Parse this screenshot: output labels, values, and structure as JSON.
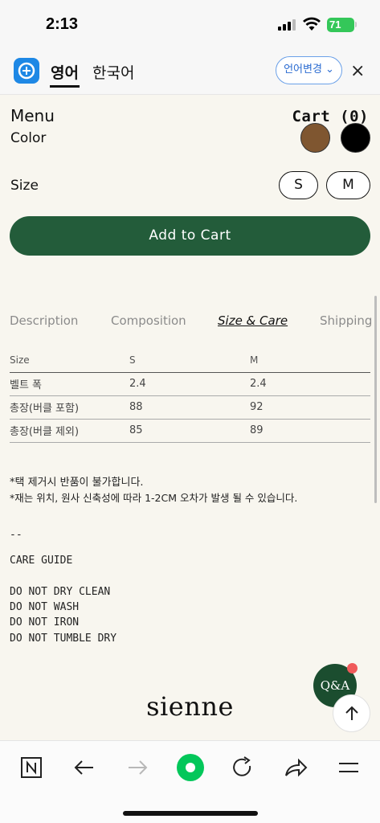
{
  "status": {
    "time": "2:13",
    "battery": "71"
  },
  "translate": {
    "tab_en": "영어",
    "tab_ko": "한국어",
    "change_label": "언어변경",
    "close": "×"
  },
  "header": {
    "menu": "Menu",
    "cart": "Cart (0)"
  },
  "options": {
    "color_label": "Color",
    "colors": [
      "#7f5630",
      "#000000"
    ],
    "size_label": "Size",
    "sizes": [
      "S",
      "M"
    ]
  },
  "add_to_cart": "Add to Cart",
  "tabs": [
    "Description",
    "Composition",
    "Size & Care",
    "Shipping"
  ],
  "active_tab": "Size & Care",
  "size_table": {
    "headers": [
      "Size",
      "S",
      "M"
    ],
    "rows": [
      [
        "벨트 폭",
        "2.4",
        "2.4"
      ],
      [
        "총장(버클 포함)",
        "88",
        "92"
      ],
      [
        "총장(버클 제외)",
        "85",
        "89"
      ]
    ]
  },
  "notes": {
    "line1": "*택 제거시 반품이 불가합니다.",
    "line2": "*재는 위치, 원사 신축성에 따라 1-2CM 오차가 발생 될 수 있습니다.",
    "divider": "--",
    "care_title": "CARE GUIDE",
    "care_items": [
      "DO NOT DRY CLEAN",
      "DO NOT WASH",
      "DO NOT IRON",
      "DO NOT TUMBLE DRY"
    ]
  },
  "brand": "sienne",
  "qa_label": "Q&A",
  "icons": {
    "signal": "signal-icon",
    "wifi": "wifi-icon",
    "close": "close-icon",
    "top": "arrow-up-icon",
    "n": "naver-icon",
    "back": "back-arrow-icon",
    "forward": "forward-arrow-icon",
    "green": "green-dot-icon",
    "refresh": "refresh-icon",
    "share": "share-icon",
    "menu": "hamburger-icon"
  }
}
